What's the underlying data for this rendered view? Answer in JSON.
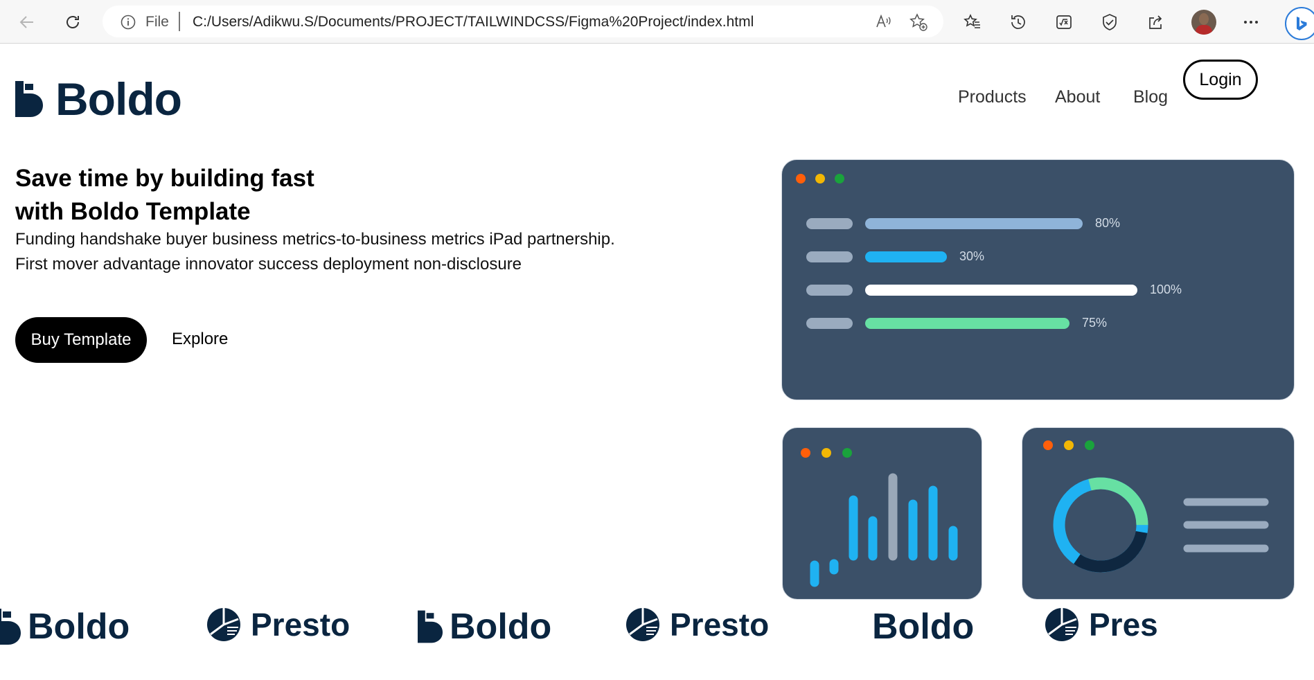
{
  "browser": {
    "file_label": "File",
    "url": "C:/Users/Adikwu.S/Documents/PROJECT/TAILWINDCSS/Figma%20Project/index.html"
  },
  "nav": {
    "brand": "Boldo",
    "items": [
      "Products",
      "About",
      "Blog"
    ],
    "login": "Login"
  },
  "hero": {
    "title_line1": "Save time by building fast",
    "title_line2": "with Boldo Template",
    "subtitle_line1": "Funding handshake buyer business metrics-to-business metrics iPad partnership.",
    "subtitle_line2": "First mover advantage innovator success deployment non-disclosure",
    "buy_label": "Buy Template",
    "explore_label": "Explore"
  },
  "dashboard": {
    "progress": [
      {
        "label": "80%",
        "value": 0.8,
        "color": "#8fb4d9"
      },
      {
        "label": "30%",
        "value": 0.3,
        "color": "#1fb2f2"
      },
      {
        "label": "100%",
        "value": 1.0,
        "color": "#ffffff"
      },
      {
        "label": "75%",
        "value": 0.75,
        "color": "#67e0a3"
      }
    ],
    "dot_colors": [
      "#ff5f0a",
      "#f2b705",
      "#1aa33c"
    ],
    "accent": "#1fb2f2"
  },
  "brands": [
    "Boldo",
    "Presto",
    "Boldo",
    "Presto",
    "Boldo",
    "Pres"
  ]
}
